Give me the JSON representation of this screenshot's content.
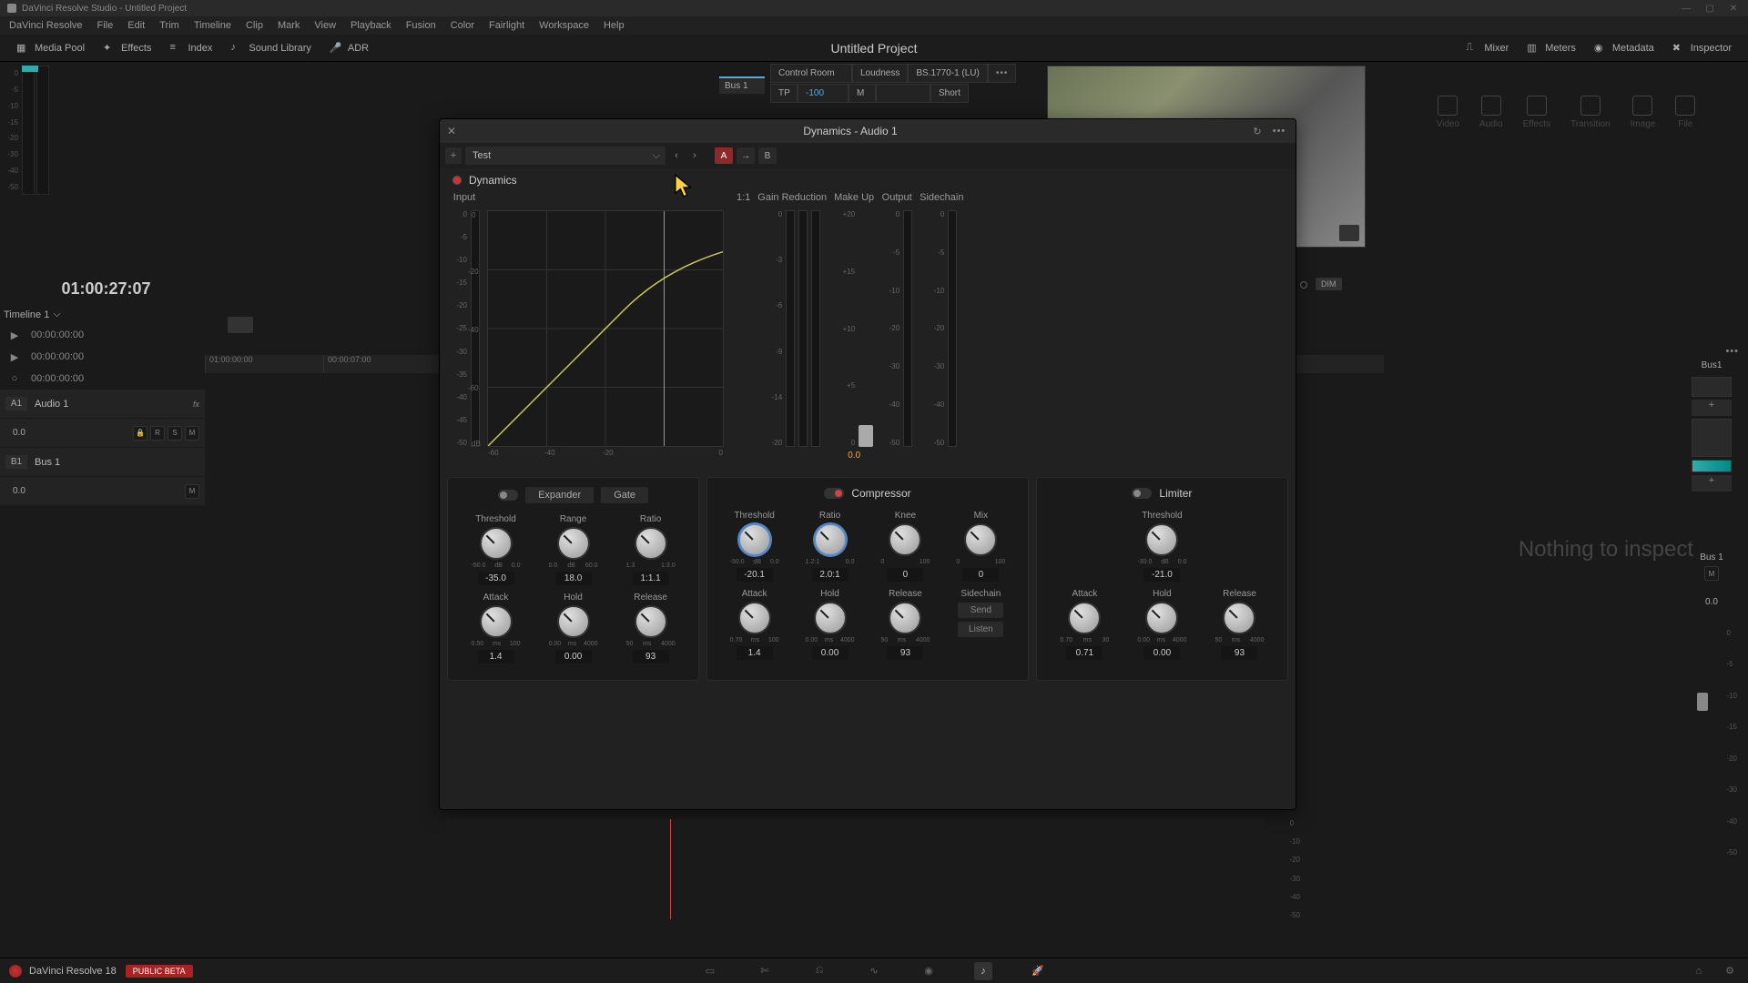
{
  "titlebar": {
    "text": "DaVinci Resolve Studio - Untitled Project"
  },
  "window_controls": {
    "min": "—",
    "max": "▢",
    "close": "✕"
  },
  "menus": [
    "DaVinci Resolve",
    "File",
    "Edit",
    "Trim",
    "Timeline",
    "Clip",
    "Mark",
    "View",
    "Playback",
    "Fusion",
    "Color",
    "Fairlight",
    "Workspace",
    "Help"
  ],
  "toolbar": {
    "media_pool": "Media Pool",
    "effects": "Effects",
    "index": "Index",
    "sound_library": "Sound Library",
    "adr": "ADR",
    "mixer": "Mixer",
    "meters": "Meters",
    "metadata": "Metadata",
    "inspector": "Inspector"
  },
  "project_title": "Untitled Project",
  "control_room": {
    "label": "Control Room",
    "bus": "Bus 1",
    "loudness": "Loudness",
    "standard": "BS.1770-1 (LU)",
    "tp": "TP",
    "tp_val": "-100",
    "m": "M",
    "short": "Short"
  },
  "dim": "DIM",
  "timecode": {
    "main": "01:00:27:07",
    "timeline_name": "Timeline 1",
    "tc1": "00:00:00:00",
    "tc2": "00:00:00:00",
    "tc3": "00:00:00:00"
  },
  "ruler": {
    "t0": "01:00:00:00",
    "t1": "00:00:07:00"
  },
  "meter_scale": [
    "0",
    "-5",
    "-10",
    "-15",
    "-20",
    "-30",
    "-40",
    "-50"
  ],
  "tracks": {
    "a1": {
      "label": "A1",
      "name": "Audio 1",
      "fx": "fx",
      "gain": "0.0",
      "r": "R",
      "s": "S",
      "m": "M"
    },
    "b1": {
      "label": "B1",
      "name": "Bus 1",
      "gain": "0.0",
      "m": "M"
    }
  },
  "inspector_tabs": [
    "Video",
    "Audio",
    "Effects",
    "Transition",
    "Image",
    "File"
  ],
  "nothing": "Nothing to inspect",
  "mixer_strip": {
    "bus1_top": "Bus1",
    "bus1_bottom": "Bus 1",
    "m": "M",
    "gain": "0.0",
    "scale": [
      "0",
      "-5",
      "-10",
      "-15",
      "-20",
      "-30",
      "-40",
      "-50"
    ]
  },
  "dynamics": {
    "title": "Dynamics - Audio 1",
    "preset": "Test",
    "ab": {
      "a": "A",
      "b": "B",
      "arrow": "→"
    },
    "section": "Dynamics",
    "labels": {
      "input": "Input",
      "gain_reduction": "Gain Reduction",
      "makeup": "Make Up",
      "output": "Output",
      "sidechain": "Sidechain",
      "ratio_11": "1:1"
    },
    "input_scale": [
      "0",
      "-5",
      "-10",
      "-15",
      "-20",
      "-25",
      "-30",
      "-35",
      "-40",
      "-45",
      "-50"
    ],
    "gr_scale": [
      "0",
      "-3",
      "-6",
      "-9",
      "-14",
      "-20"
    ],
    "makeup_scale": [
      "+20",
      "+15",
      "+10",
      "+5",
      "0"
    ],
    "makeup_value": "0.0",
    "out_scale": [
      "0",
      "-5",
      "-10",
      "-20",
      "-30",
      "-40",
      "-50"
    ],
    "graph": {
      "db": "dB",
      "ticks": [
        "-60",
        "-40",
        "-20",
        "0"
      ],
      "yticks": [
        "0",
        "-20",
        "-40",
        "-60"
      ]
    },
    "expander": {
      "tabs": {
        "expander": "Expander",
        "gate": "Gate"
      },
      "threshold": {
        "label": "Threshold",
        "min": "-50.0",
        "max_l": "dB",
        "max": "0.0",
        "value": "-35.0"
      },
      "range": {
        "label": "Range",
        "min": "0.0",
        "max_l": "dB",
        "max": "60.0",
        "value": "18.0"
      },
      "ratio": {
        "label": "Ratio",
        "min": "1.3",
        "max": "1:3.0",
        "value": "1:1.1"
      },
      "attack": {
        "label": "Attack",
        "min": "0.50",
        "unit": "ms",
        "max": "100",
        "value": "1.4"
      },
      "hold": {
        "label": "Hold",
        "min": "0.00",
        "unit": "ms",
        "max": "4000",
        "value": "0.00"
      },
      "release": {
        "label": "Release",
        "min": "50",
        "unit": "ms",
        "max": "4000",
        "value": "93"
      }
    },
    "compressor": {
      "title": "Compressor",
      "threshold": {
        "label": "Threshold",
        "min": "-50.0",
        "max_l": "dB",
        "max": "0.0",
        "value": "-20.1"
      },
      "ratio": {
        "label": "Ratio",
        "min": "1.2:1",
        "max": "0.0",
        "value": "2.0:1"
      },
      "knee": {
        "label": "Knee",
        "min": "0",
        "max": "100",
        "value": "0"
      },
      "mix": {
        "label": "Mix",
        "min": "0",
        "max": "100",
        "value": "0"
      },
      "attack": {
        "label": "Attack",
        "min": "0.70",
        "unit": "ms",
        "max": "100",
        "value": "1.4"
      },
      "hold": {
        "label": "Hold",
        "min": "0.00",
        "unit": "ms",
        "max": "4000",
        "value": "0.00"
      },
      "release": {
        "label": "Release",
        "min": "50",
        "unit": "ms",
        "max": "4000",
        "value": "93"
      },
      "sidechain": {
        "label": "Sidechain",
        "send": "Send",
        "listen": "Listen"
      }
    },
    "limiter": {
      "title": "Limiter",
      "threshold": {
        "label": "Threshold",
        "min": "-30.0",
        "max_l": "dB",
        "max": "0.0",
        "value": "-21.0"
      },
      "attack": {
        "label": "Attack",
        "min": "0.70",
        "unit": "ms",
        "max": "30",
        "value": "0.71"
      },
      "hold": {
        "label": "Hold",
        "min": "0.00",
        "unit": "ms",
        "max": "4000",
        "value": "0.00"
      },
      "release": {
        "label": "Release",
        "min": "50",
        "unit": "ms",
        "max": "4000",
        "value": "93"
      }
    }
  },
  "bottom": {
    "app": "DaVinci Resolve 18",
    "badge": "PUBLIC BETA"
  },
  "lower_scale": [
    "0",
    "-10",
    "-20",
    "-30",
    "-40",
    "-50"
  ]
}
